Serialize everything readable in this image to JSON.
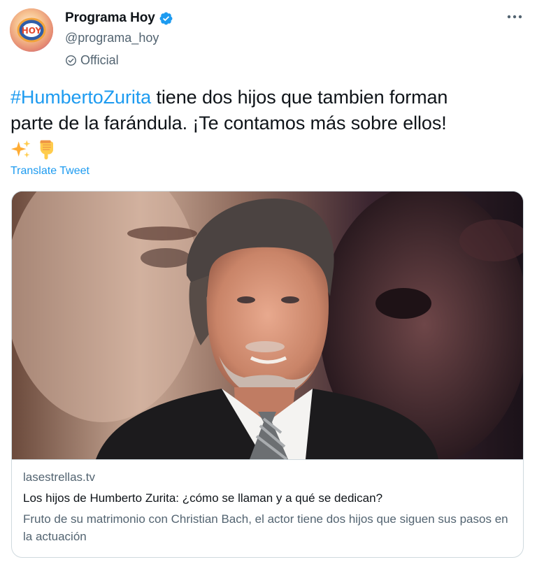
{
  "author": {
    "display_name": "Programa Hoy",
    "handle": "@programa_hoy",
    "label": "Official",
    "avatar_text": "HOY"
  },
  "tweet": {
    "hashtag": "#HumbertoZurita",
    "text_line1_rest": " tiene dos hijos que tambien forman",
    "text_line2": "parte de la farándula. ¡Te contamos más sobre ellos!",
    "emojis": [
      "sparkles-emoji",
      "backhand-index-pointing-down-emoji"
    ],
    "translate_label": "Translate Tweet"
  },
  "card": {
    "domain": "lasestrellas.tv",
    "title": "Los hijos de Humberto Zurita: ¿cómo se llaman y a qué se dedican?",
    "description": "Fruto de su matrimonio con Christian Bach, el actor tiene dos hijos que siguen sus pasos en la actuación"
  },
  "colors": {
    "link_blue": "#1d9bf0",
    "secondary_text": "#536471",
    "primary_text": "#0f1419",
    "border": "#cfd9de"
  }
}
